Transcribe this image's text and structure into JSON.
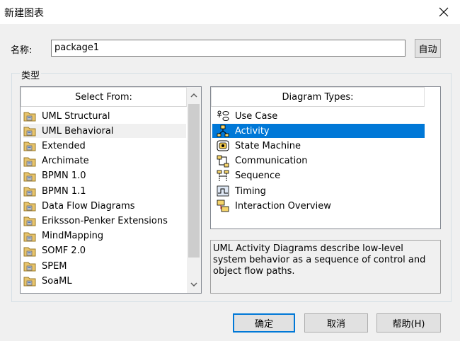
{
  "window": {
    "title": "新建图表"
  },
  "name_field": {
    "label": "名称:",
    "value": "package1",
    "auto_button": "自动"
  },
  "type_group": {
    "label": "类型"
  },
  "select_from": {
    "header": "Select From:",
    "items": [
      {
        "label": "UML Structural"
      },
      {
        "label": "UML Behavioral"
      },
      {
        "label": "Extended"
      },
      {
        "label": "Archimate"
      },
      {
        "label": "BPMN 1.0"
      },
      {
        "label": "BPMN 1.1"
      },
      {
        "label": "Data Flow Diagrams"
      },
      {
        "label": "Eriksson-Penker Extensions"
      },
      {
        "label": "MindMapping"
      },
      {
        "label": "SOMF 2.0"
      },
      {
        "label": "SPEM"
      },
      {
        "label": "SoaML"
      }
    ],
    "selected_index": 1
  },
  "diagram_types": {
    "header": "Diagram Types:",
    "items": [
      {
        "label": "Use Case",
        "icon": "use-case-icon"
      },
      {
        "label": "Activity",
        "icon": "activity-icon"
      },
      {
        "label": "State Machine",
        "icon": "state-machine-icon"
      },
      {
        "label": "Communication",
        "icon": "communication-icon"
      },
      {
        "label": "Sequence",
        "icon": "sequence-icon"
      },
      {
        "label": "Timing",
        "icon": "timing-icon"
      },
      {
        "label": "Interaction Overview",
        "icon": "interaction-overview-icon"
      }
    ],
    "selected_index": 1
  },
  "description": "UML Activity Diagrams describe low-level system behavior as a sequence of control and object flow paths.",
  "buttons": {
    "ok": "确定",
    "cancel": "取消",
    "help": "帮助(H)"
  },
  "colors": {
    "selection": "#0078d7",
    "folder": "#e8c46b"
  }
}
